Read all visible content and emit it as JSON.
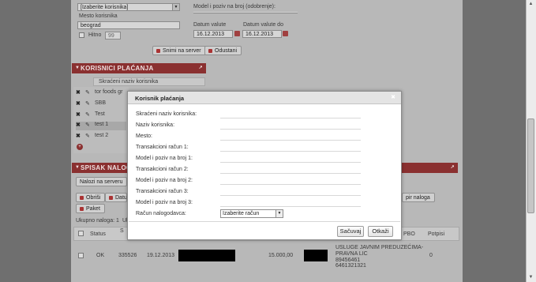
{
  "top_form": {
    "select_value": "[Izaberite korisnika]",
    "model_label": "Model i poziv na broj (odobrenje):",
    "mesto_label": "Mesto korisnika",
    "mesto_value": "beograd",
    "hitno_label": "Hitno",
    "hitno_select": "99",
    "datum_valute_label": "Datum valute",
    "datum_valute_value": "16.12.2013",
    "datum_valute_do_label": "Datum valute do",
    "datum_valute_do_value": "16.12.2013",
    "save_button": "Snimi na server",
    "cancel_button": "Odustani"
  },
  "korisnici_panel": {
    "title": "KORISNICI PLAĆANJA",
    "column_header": "Skraćeni naziv korisnika",
    "rows": [
      "tor foods gr",
      "SBB",
      "Test",
      "test 1",
      "test 2"
    ]
  },
  "nalozi_panel": {
    "title": "SPISAK NALOG",
    "tab_label": "Nalozi na serveru",
    "obrisi_button": "Obriši",
    "datum_button": "Datu",
    "kopiraj_button": "pir naloga",
    "paket_button": "Paket",
    "ukupno_label": "Ukupno naloga: 1",
    "ukupno_suffix": "Uk",
    "columns": {
      "status": "Status",
      "s": "S",
      "pbo": "PBO",
      "potpisi": "Potpisi"
    },
    "row": {
      "status": "OK",
      "number": "335526",
      "date": "19.12.2013",
      "amount": "15.000,00",
      "description_line1": "USLUGE JAVNIM PREDUZEĆIMA-",
      "description_line2": "PRAVNA LIC",
      "account1": "89456461",
      "account2": "6461321321",
      "potpisi": "0"
    }
  },
  "modal": {
    "title": "Korisnik plaćanja",
    "fields": [
      {
        "label": "Skraćeni naziv korisnika:",
        "value": ""
      },
      {
        "label": "Naziv korisnika:",
        "value": ""
      },
      {
        "label": "Mesto:",
        "value": ""
      },
      {
        "label": "Transakcioni račun 1:",
        "value": ""
      },
      {
        "label": "Model i poziv na broj 1:",
        "value": ""
      },
      {
        "label": "Transakcioni račun 2:",
        "value": ""
      },
      {
        "label": "Model i poziv na broj 2:",
        "value": ""
      },
      {
        "label": "Transakcioni račun 3:",
        "value": ""
      },
      {
        "label": "Model i poziv na broj 3:",
        "value": ""
      }
    ],
    "nalogodavac_label": "Račun nalogodavca:",
    "nalogodavac_select": "Izaberite račun",
    "save_button": "Sačuvaj",
    "cancel_button": "Otkaži"
  },
  "colors": {
    "panel_header": "#8a3030",
    "overlay": "#b8b8b8",
    "gutter": "#6f6f6f"
  },
  "icons": [
    "close-icon",
    "edit-icon",
    "calendar-icon",
    "chevron-down-icon",
    "save-icon",
    "undo-icon",
    "add-icon"
  ]
}
